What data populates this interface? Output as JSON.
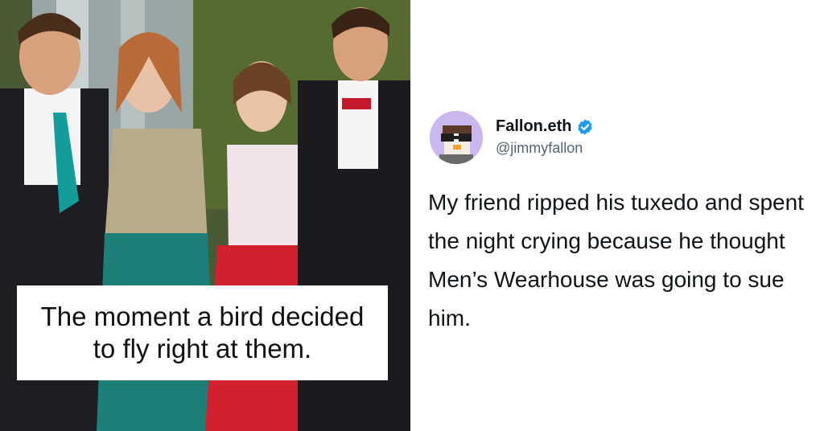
{
  "photo": {
    "caption": "The moment a bird decided to fly right at them."
  },
  "tweet": {
    "display_name": "Fallon.eth",
    "handle": "@jimmyfallon",
    "text": "My friend ripped his tuxedo and spent the night crying because he thought Men’s Wearhouse was going to sue him.",
    "verified_color": "#1d9bf0",
    "avatar_bg": "#c9b7ee"
  }
}
